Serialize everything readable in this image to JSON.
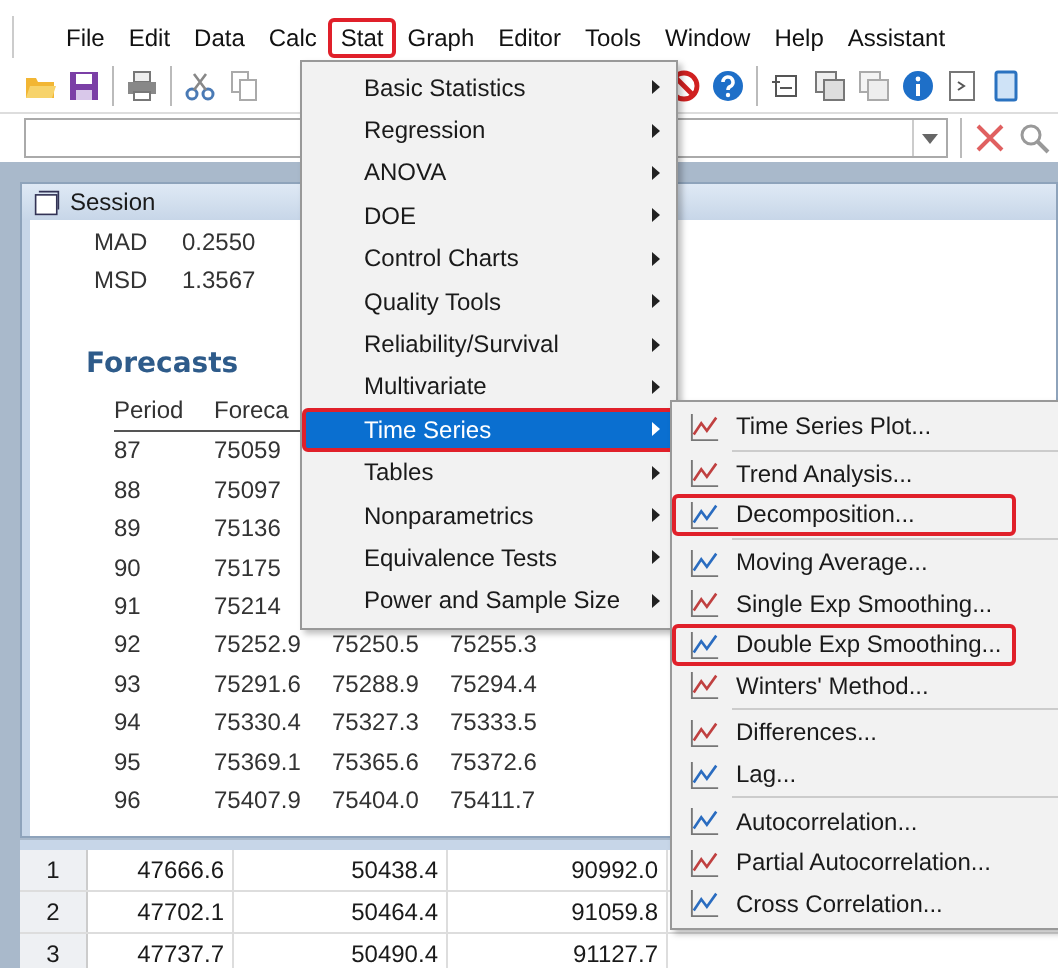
{
  "menubar": [
    {
      "label": "File",
      "highlighted": false
    },
    {
      "label": "Edit",
      "highlighted": false
    },
    {
      "label": "Data",
      "highlighted": false
    },
    {
      "label": "Calc",
      "highlighted": false
    },
    {
      "label": "Stat",
      "highlighted": true
    },
    {
      "label": "Graph",
      "highlighted": false
    },
    {
      "label": "Editor",
      "highlighted": false
    },
    {
      "label": "Tools",
      "highlighted": false
    },
    {
      "label": "Window",
      "highlighted": false
    },
    {
      "label": "Help",
      "highlighted": false
    },
    {
      "label": "Assistant",
      "highlighted": false
    }
  ],
  "stat_menu": {
    "items": [
      {
        "label": "Basic Statistics",
        "selected": false,
        "highlighted": false
      },
      {
        "label": "Regression",
        "selected": false,
        "highlighted": false
      },
      {
        "label": "ANOVA",
        "selected": false,
        "highlighted": false
      },
      {
        "label": "DOE",
        "selected": false,
        "highlighted": false
      },
      {
        "label": "Control Charts",
        "selected": false,
        "highlighted": false
      },
      {
        "label": "Quality Tools",
        "selected": false,
        "highlighted": false
      },
      {
        "label": "Reliability/Survival",
        "selected": false,
        "highlighted": false
      },
      {
        "label": "Multivariate",
        "selected": false,
        "highlighted": false
      },
      {
        "label": "Time Series",
        "selected": true,
        "highlighted": true
      },
      {
        "label": "Tables",
        "selected": false,
        "highlighted": false
      },
      {
        "label": "Nonparametrics",
        "selected": false,
        "highlighted": false
      },
      {
        "label": "Equivalence Tests",
        "selected": false,
        "highlighted": false
      },
      {
        "label": "Power and Sample Size",
        "selected": false,
        "highlighted": false
      }
    ]
  },
  "time_series_menu": {
    "items": [
      {
        "kind": "item",
        "label": "Time Series Plot...",
        "highlighted": false
      },
      {
        "kind": "separator"
      },
      {
        "kind": "item",
        "label": "Trend Analysis...",
        "highlighted": false
      },
      {
        "kind": "item",
        "label": "Decomposition...",
        "highlighted": true
      },
      {
        "kind": "separator"
      },
      {
        "kind": "item",
        "label": "Moving Average...",
        "highlighted": false
      },
      {
        "kind": "item",
        "label": "Single Exp Smoothing...",
        "highlighted": false
      },
      {
        "kind": "item",
        "label": "Double Exp Smoothing...",
        "highlighted": true
      },
      {
        "kind": "item",
        "label": "Winters' Method...",
        "highlighted": false
      },
      {
        "kind": "separator"
      },
      {
        "kind": "item",
        "label": "Differences...",
        "highlighted": false
      },
      {
        "kind": "item",
        "label": "Lag...",
        "highlighted": false
      },
      {
        "kind": "separator"
      },
      {
        "kind": "item",
        "label": "Autocorrelation...",
        "highlighted": false
      },
      {
        "kind": "item",
        "label": "Partial Autocorrelation...",
        "highlighted": false
      },
      {
        "kind": "item",
        "label": "Cross Correlation...",
        "highlighted": false
      }
    ]
  },
  "session": {
    "title": "Session",
    "stats": [
      {
        "label": "MAD",
        "value": "0.2550"
      },
      {
        "label": "MSD",
        "value": "1.3567"
      }
    ],
    "heading": "Forecasts",
    "columns": [
      "Period",
      "Foreca"
    ],
    "rows": [
      [
        "87",
        "75059"
      ],
      [
        "88",
        "75097"
      ],
      [
        "89",
        "75136"
      ],
      [
        "90",
        "75175"
      ],
      [
        "91",
        "75214"
      ],
      [
        "92",
        "75252.9",
        "75250.5",
        "75255.3"
      ],
      [
        "93",
        "75291.6",
        "75288.9",
        "75294.4"
      ],
      [
        "94",
        "75330.4",
        "75327.3",
        "75333.5"
      ],
      [
        "95",
        "75369.1",
        "75365.6",
        "75372.6"
      ],
      [
        "96",
        "75407.9",
        "75404.0",
        "75411.7"
      ]
    ]
  },
  "worksheet": {
    "rows": [
      {
        "row": "1",
        "cells": [
          "47666.6",
          "50438.4",
          "90992.0"
        ]
      },
      {
        "row": "2",
        "cells": [
          "47702.1",
          "50464.4",
          "91059.8"
        ]
      },
      {
        "row": "3",
        "cells": [
          "47737.7",
          "50490.4",
          "91127.7"
        ]
      }
    ]
  }
}
